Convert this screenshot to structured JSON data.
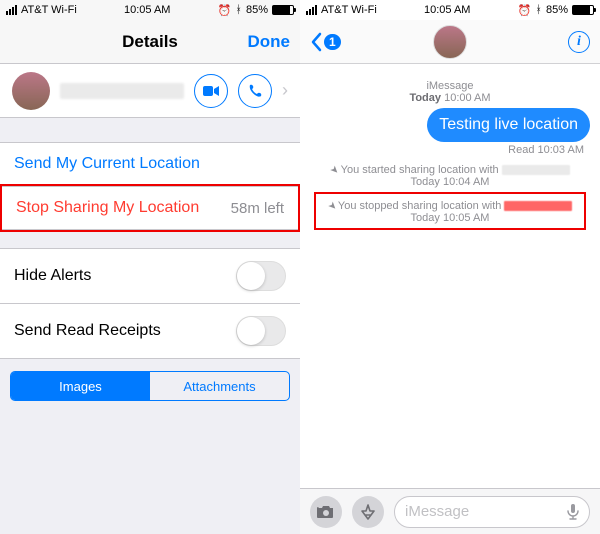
{
  "status": {
    "carrier": "AT&T Wi-Fi",
    "time": "10:05 AM",
    "battery_pct": "85%"
  },
  "left": {
    "title": "Details",
    "done": "Done",
    "send_current": "Send My Current Location",
    "stop_sharing": "Stop Sharing My Location",
    "stop_sharing_sub": "58m left",
    "hide_alerts": "Hide Alerts",
    "read_receipts": "Send Read Receipts",
    "seg_images": "Images",
    "seg_attachments": "Attachments"
  },
  "right": {
    "back_count": "1",
    "thread_label": "iMessage",
    "thread_day": "Today",
    "thread_time": "10:00 AM",
    "outgoing_msg": "Testing live location",
    "read_label": "Read",
    "read_time": "10:03 AM",
    "evt_start": "You started sharing location with",
    "evt_start_time": "10:04 AM",
    "evt_stop": "You stopped sharing location with",
    "evt_stop_time": "10:05 AM",
    "evt_day": "Today",
    "input_placeholder": "iMessage"
  }
}
